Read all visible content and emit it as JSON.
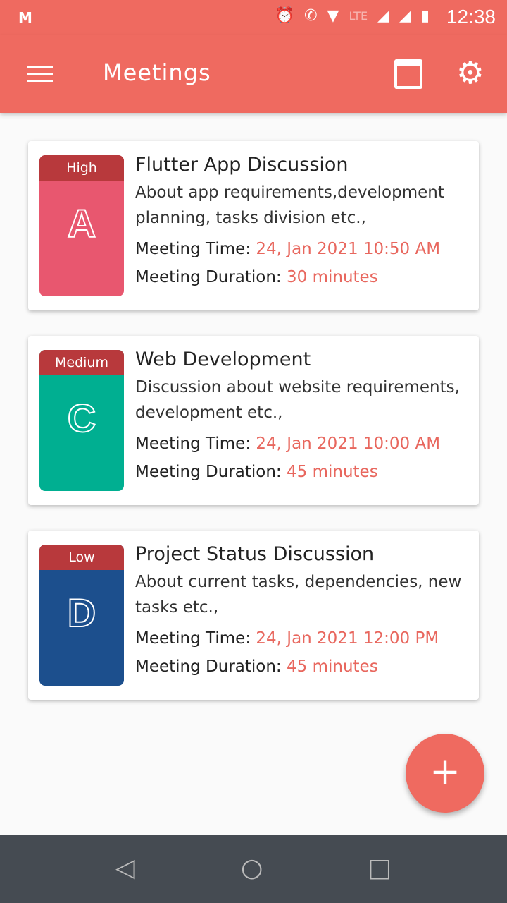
{
  "status": {
    "carrier": "M",
    "time": "12:38",
    "icons": [
      "alarm-icon",
      "call-lte-icon",
      "wifi-icon",
      "lte-icon",
      "signal-icon",
      "signal-icon",
      "battery-icon"
    ],
    "lte": "LTE"
  },
  "appbar": {
    "title": "Meetings"
  },
  "meetings": [
    {
      "priority": "High",
      "letter": "A",
      "color": "#e8576f",
      "title": "Flutter App Discussion",
      "desc": "About app requirements,development planning, tasks division etc.,",
      "time_label": "Meeting Time:",
      "time": "24, Jan 2021 10:50 AM",
      "dur_label": "Meeting Duration:",
      "duration": "30 minutes"
    },
    {
      "priority": "Medium",
      "letter": "C",
      "color": "#00af91",
      "title": "Web Development",
      "desc": "Discussion about website requirements, development etc.,",
      "time_label": "Meeting Time:",
      "time": "24, Jan 2021 10:00 AM",
      "dur_label": "Meeting Duration:",
      "duration": "45 minutes"
    },
    {
      "priority": "Low",
      "letter": "D",
      "color": "#1c4f8d",
      "title": "Project Status Discussion",
      "desc": "About current tasks, dependencies, new tasks etc.,",
      "time_label": "Meeting Time:",
      "time": "24, Jan 2021 12:00 PM",
      "dur_label": "Meeting Duration:",
      "duration": "45 minutes"
    }
  ],
  "fab": {
    "label": "+"
  },
  "nav": {
    "back": "◁",
    "home": "○",
    "recents": "□"
  }
}
